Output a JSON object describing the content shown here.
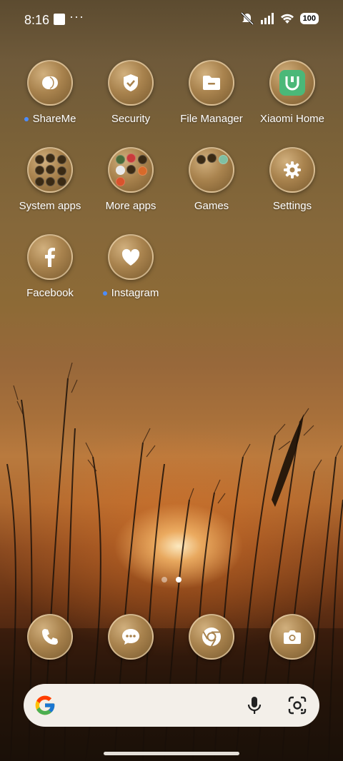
{
  "status_bar": {
    "time": "8:16",
    "more_dots": "···",
    "battery": "100"
  },
  "apps": [
    {
      "label": "ShareMe",
      "icon": "shareme-icon",
      "new": true
    },
    {
      "label": "Security",
      "icon": "shield-icon",
      "new": false
    },
    {
      "label": "File Manager",
      "icon": "folder-icon",
      "new": false
    },
    {
      "label": "Xiaomi Home",
      "icon": "xiaomi-home-icon",
      "new": false
    },
    {
      "label": "System apps",
      "icon": "folder-icon",
      "new": false
    },
    {
      "label": "More apps",
      "icon": "folder-icon",
      "new": false
    },
    {
      "label": "Games",
      "icon": "folder-icon",
      "new": false
    },
    {
      "label": "Settings",
      "icon": "gear-icon",
      "new": false
    },
    {
      "label": "Facebook",
      "icon": "facebook-icon",
      "new": false
    },
    {
      "label": "Instagram",
      "icon": "heart-icon",
      "new": true
    }
  ],
  "dock": [
    {
      "name": "phone",
      "icon": "phone-icon"
    },
    {
      "name": "messages",
      "icon": "message-icon"
    },
    {
      "name": "chrome",
      "icon": "chrome-icon"
    },
    {
      "name": "camera",
      "icon": "camera-icon"
    }
  ],
  "page_indicator": {
    "pages": 2,
    "current": 2
  },
  "colors": {
    "accent_dot": "#4c8dff",
    "icon_gold": "#a9834e",
    "search_bg": "#f3efe9"
  }
}
